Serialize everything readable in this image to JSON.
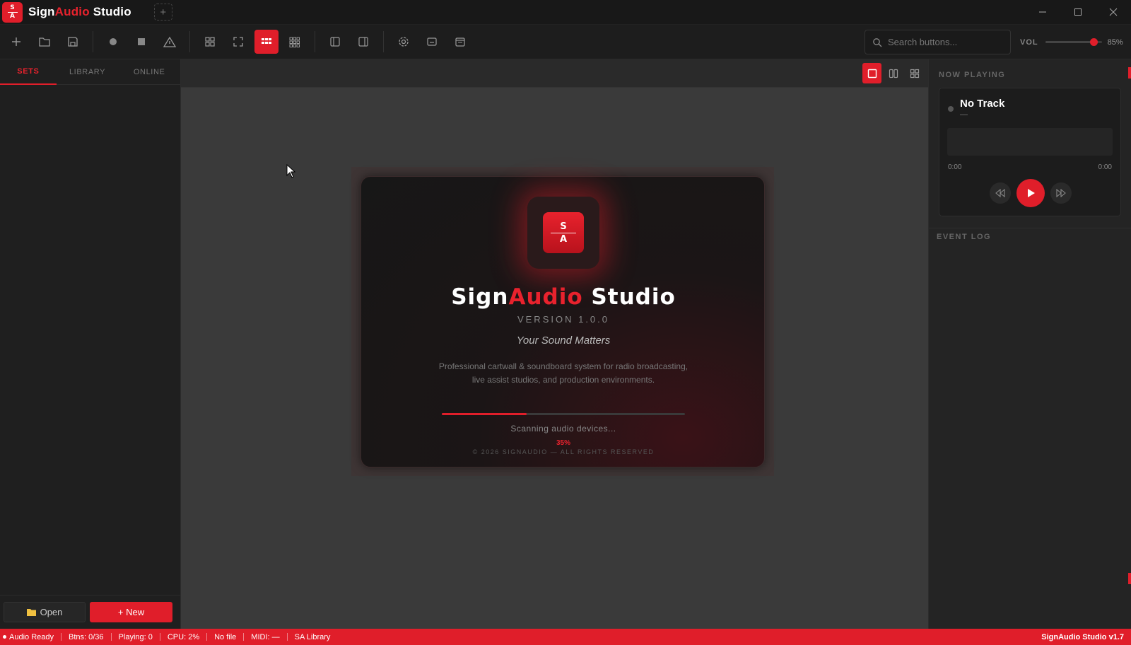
{
  "app": {
    "logo_top": "S",
    "logo_bottom": "A",
    "title_part1": "Sign",
    "title_part2": "Audio",
    "title_part3": " Studio",
    "tab_add": "+"
  },
  "toolbar": {
    "search_placeholder": "Search buttons...",
    "vol_label": "VOL",
    "vol_value": 85,
    "vol_text": "85%"
  },
  "sidebar": {
    "tabs": [
      "SETS",
      "LIBRARY",
      "ONLINE"
    ],
    "active_tab": "SETS",
    "open_label": "Open",
    "new_label": "+ New"
  },
  "splash": {
    "icon_top": "S",
    "icon_bottom": "A",
    "title_part1": "Sign",
    "title_part2": "Audio",
    "title_part3": " Studio",
    "version": "VERSION 1.0.0",
    "tagline": "Your Sound Matters",
    "desc_line1": "Professional cartwall & soundboard system for radio broadcasting,",
    "desc_line2": "live assist studios, and production environments.",
    "progress": 35,
    "status": "Scanning audio devices...",
    "progress_text": "35%",
    "copyright": "© 2026 SIGNAUDIO — ALL RIGHTS RESERVED"
  },
  "now_playing": {
    "section_label": "NOW PLAYING",
    "track": "No Track",
    "artist": "—",
    "time_elapsed": "0:00",
    "time_total": "0:00"
  },
  "event_log": {
    "section_label": "EVENT LOG"
  },
  "statusbar": {
    "audio": "Audio Ready",
    "buttons": "Btns: 0/36",
    "playing": "Playing: 0",
    "cpu": "CPU: 2%",
    "file": "No file",
    "midi": "MIDI: —",
    "library": "SA Library",
    "version": "SignAudio Studio v1.7"
  },
  "colors": {
    "accent": "#e01e2a",
    "background": "#1c1c1c",
    "canvas": "#3a3a3a"
  }
}
